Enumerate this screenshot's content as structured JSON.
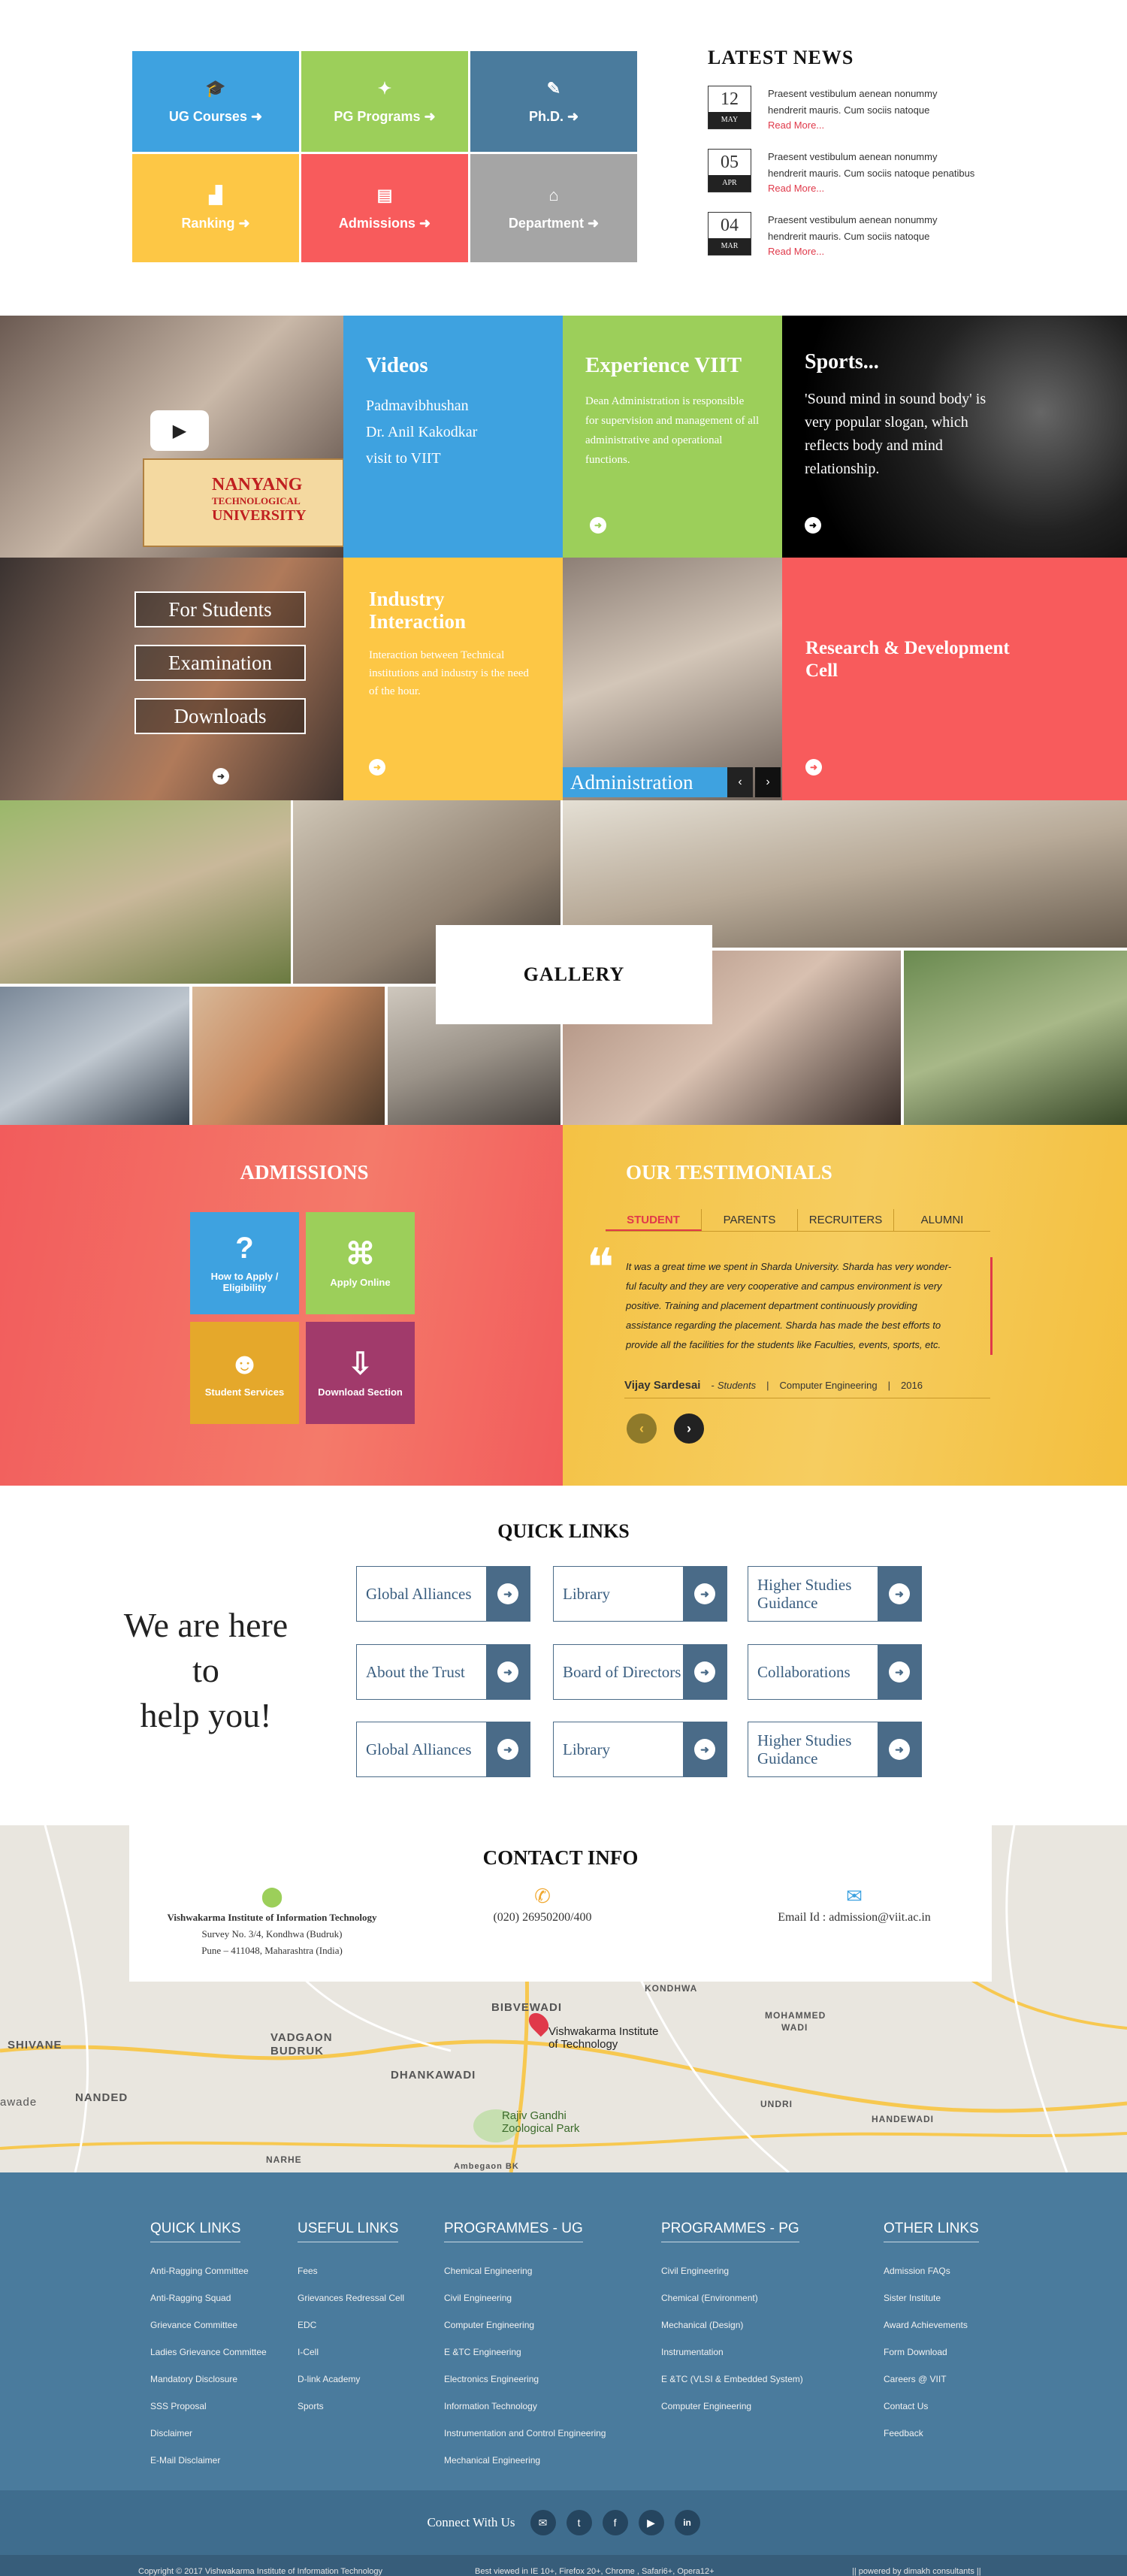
{
  "tiles": [
    {
      "label": "UG Courses",
      "icon": "graduation-cap-icon",
      "color": "#3ea2e0"
    },
    {
      "label": "PG Programs",
      "icon": "handshake-icon",
      "color": "#9ccf5a"
    },
    {
      "label": "Ph.D.",
      "icon": "scholar-icon",
      "color": "#4a7b9d"
    },
    {
      "label": "Ranking",
      "icon": "bar-chart-icon",
      "color": "#fdc745"
    },
    {
      "label": "Admissions",
      "icon": "document-icon",
      "color": "#f85b5c"
    },
    {
      "label": "Department",
      "icon": "institution-icon",
      "color": "#a5a5a5"
    }
  ],
  "news": {
    "title": "LATEST NEWS",
    "items": [
      {
        "day": "12",
        "month": "MAY",
        "line1": "Praesent vestibulum aenean nonummy",
        "line2": "hendrerit mauris. Cum sociis natoque",
        "more": "Read More..."
      },
      {
        "day": "05",
        "month": "APR",
        "line1": "Praesent vestibulum aenean nonummy",
        "line2": "hendrerit mauris. Cum sociis natoque penatibus",
        "more": "Read More..."
      },
      {
        "day": "04",
        "month": "MAR",
        "line1": "Praesent vestibulum aenean nonummy",
        "line2": "hendrerit mauris. Cum sociis natoque",
        "more": "Read More..."
      }
    ]
  },
  "video_thumb": {
    "line1": "NANYANG",
    "line2": "TECHNOLOGICAL",
    "line3": "UNIVERSITY"
  },
  "videos": {
    "title": "Videos",
    "lines": [
      "Padmavibhushan",
      "Dr. Anil Kakodkar",
      "visit to VIIT"
    ]
  },
  "experience": {
    "title": "Experience VIIT",
    "text": "Dean Administration is responsible for supervision and management of all administrative and operational functions."
  },
  "sports": {
    "title": "Sports...",
    "text": "'Sound mind in sound body' is very popular slogan, which reflects body and mind relationship."
  },
  "student_btns": [
    "For Students",
    "Examination",
    "Downloads"
  ],
  "industry": {
    "title": "Industry Interaction",
    "text": "Interaction between Technical institutions and industry is the need of the hour."
  },
  "administration": {
    "label": "Administration"
  },
  "research": {
    "title": "Research & Development Cell"
  },
  "gallery": {
    "title": "GALLERY"
  },
  "admissions": {
    "title": "ADMISSIONS",
    "boxes": [
      {
        "label": "How to Apply / Eligibility",
        "icon": "question-icon",
        "color": "#3ea2e0"
      },
      {
        "label": "Apply Online",
        "icon": "mouse-icon",
        "color": "#9ccf5a"
      },
      {
        "label": "Student Services",
        "icon": "users-icon",
        "color": "#e5a82b"
      },
      {
        "label": "Download Section",
        "icon": "download-icon",
        "color": "#a13a6b"
      }
    ]
  },
  "testimonials": {
    "title": "OUR TESTIMONIALS",
    "tabs": [
      "STUDENT",
      "PARENTS",
      "RECRUITERS",
      "ALUMNI"
    ],
    "active_tab": "STUDENT",
    "quote_lines": [
      "It was a great time we spent in Sharda University. Sharda has very wonder-",
      "ful faculty and they are very cooperative and campus environment is very",
      "positive. Training and placement department continuously providing",
      "assistance regarding the placement. Sharda has made the best efforts to",
      "provide all the facilities for the students like Faculties, events, sports, etc."
    ],
    "author": "Vijay Sardesai",
    "role": "Students",
    "dept": "Computer Engineering",
    "year": "2016"
  },
  "quick_links": {
    "title": "QUICK LINKS",
    "tagline": [
      "We are here",
      "to",
      "help you!"
    ],
    "items": [
      "Global Alliances",
      "Library",
      "Higher Studies Guidance",
      "About the Trust",
      "Board of Directors",
      "Collaborations",
      "Global Alliances",
      "Library",
      "Higher Studies Guidance"
    ]
  },
  "contact": {
    "title": "CONTACT INFO",
    "org": "Vishwakarma Institute of Information Technology",
    "addr1": "Survey No. 3/4, Kondhwa (Budruk)",
    "addr2": "Pune – 411048, Maharashtra (India)",
    "phone": "(020) 26950200/400",
    "email": "Email Id : admission@viit.ac.in"
  },
  "map": {
    "labels": [
      "BIBVEWADI",
      "VADGAON",
      "BUDRUK",
      "DHANKAWADI",
      "SHIVANE",
      "NANDED",
      "awade",
      "NARHE",
      "MOHAMMED",
      "WADI",
      "UNDRI",
      "HANDEWADI",
      "KONDHWA",
      "Ambegaon BK"
    ],
    "pin_label": [
      "Vishwakarma Institute",
      "of Technology"
    ],
    "zoo_label": [
      "Rajiv Gandhi",
      "Zoological Park"
    ]
  },
  "footer": {
    "cols": [
      {
        "title": "QUICK LINKS",
        "links": [
          "Anti-Ragging Committee",
          "Anti-Ragging Squad",
          "Grievance Committee",
          "Ladies Grievance Committee",
          "Mandatory Disclosure",
          "SSS Proposal",
          "Disclaimer",
          "E-Mail Disclaimer"
        ]
      },
      {
        "title": "USEFUL LINKS",
        "links": [
          "Fees",
          "Grievances Redressal Cell",
          "EDC",
          "I-Cell",
          "D-link Academy",
          "Sports"
        ]
      },
      {
        "title": "PROGRAMMES - UG",
        "links": [
          "Chemical Engineering",
          "Civil Engineering",
          "Computer Engineering",
          "E &TC Engineering",
          "Electronics Engineering",
          "Information Technology",
          "Instrumentation and Control Engineering",
          "Mechanical Engineering"
        ]
      },
      {
        "title": "PROGRAMMES - PG",
        "links": [
          "Civil Engineering",
          "Chemical (Environment)",
          "Mechanical (Design)",
          "Instrumentation",
          "E &TC (VLSI & Embedded System)",
          "Computer Engineering"
        ]
      },
      {
        "title": "OTHER LINKS",
        "links": [
          "Admission FAQs",
          "Sister Institute",
          "Award Achievements",
          "Form Download",
          "Careers @ VIIT",
          "Contact Us",
          "Feedback"
        ]
      }
    ],
    "connect": "Connect With Us",
    "social": [
      {
        "icon": "email-icon",
        "glyph": "✉"
      },
      {
        "icon": "twitter-icon",
        "glyph": "t"
      },
      {
        "icon": "facebook-icon",
        "glyph": "f"
      },
      {
        "icon": "youtube-icon",
        "glyph": "▶"
      },
      {
        "icon": "linkedin-icon",
        "glyph": "in"
      }
    ],
    "copyright": "Copyright © 2017 Vishwakarma Institute of Information Technology",
    "browsers": "Best viewed in IE 10+, Firefox 20+, Chrome , Safari6+, Opera12+",
    "powered": "|| powered by dimakh consultants ||"
  }
}
